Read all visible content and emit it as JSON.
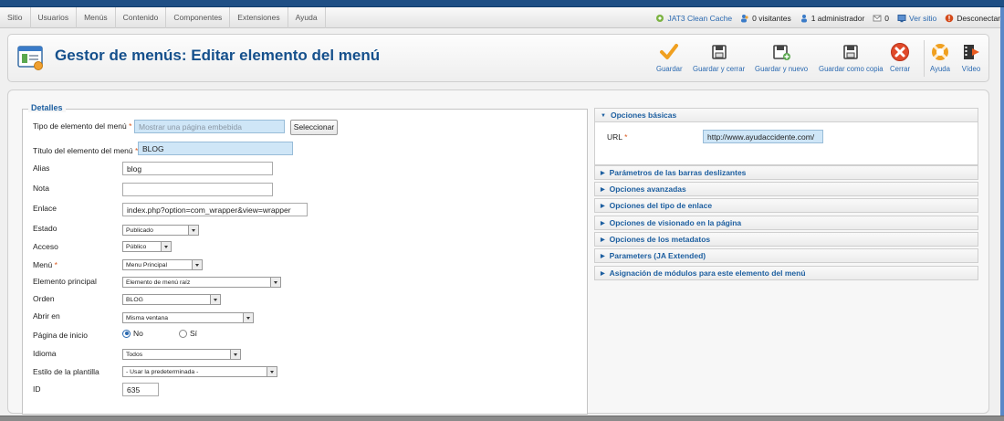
{
  "menu": [
    "Sitio",
    "Usuarios",
    "Menús",
    "Contenido",
    "Componentes",
    "Extensiones",
    "Ayuda"
  ],
  "status": {
    "cache": "JAT3 Clean Cache",
    "visitors": "0 visitantes",
    "admins": "1 administrador",
    "messages": "0",
    "view_site": "Ver sitio",
    "logout": "Desconectar"
  },
  "header": {
    "title": "Gestor de menús: Editar elemento del menú"
  },
  "toolbar": {
    "save": "Guardar",
    "save_close": "Guardar y cerrar",
    "save_new": "Guardar y nuevo",
    "save_copy": "Guardar como copia",
    "close": "Cerrar",
    "help": "Ayuda",
    "video": "Vídeo"
  },
  "details": {
    "legend": "Detalles",
    "type_label": "Tipo de elemento del menú",
    "type_value": "Mostrar una página embebida",
    "select_button": "Seleccionar",
    "title_label": "Título del elemento del menú",
    "title_value": "BLOG",
    "alias_label": "Alias",
    "alias_value": "blog",
    "note_label": "Nota",
    "note_value": "",
    "link_label": "Enlace",
    "link_value": "index.php?option=com_wrapper&view=wrapper",
    "state_label": "Estado",
    "state_value": "Publicado",
    "access_label": "Acceso",
    "access_value": "Público",
    "menu_label": "Menú",
    "menu_value": "Menu Principal",
    "parent_label": "Elemento principal",
    "parent_value": "Elemento de menú raíz",
    "order_label": "Orden",
    "order_value": "BLOG",
    "target_label": "Abrir en",
    "target_value": "Misma ventana",
    "home_label": "Página de inicio",
    "home_no": "No",
    "home_yes": "Sí",
    "home_selected": "No",
    "language_label": "Idioma",
    "language_value": "Todos",
    "template_label": "Estilo de la plantilla",
    "template_value": "- Usar la predeterminada -",
    "id_label": "ID",
    "id_value": "635"
  },
  "required_mark": "*",
  "right_panels": {
    "basic_title": "Opciones básicas",
    "url_label": "URL",
    "url_value": "http://www.ayudaccidente.com/",
    "collapsed": [
      "Parámetros de las barras deslizantes",
      "Opciones avanzadas",
      "Opciones del tipo de enlace",
      "Opciones de visionado en la página",
      "Opciones de los metadatos",
      "Parameters (JA Extended)",
      "Asignación de módulos para este elemento del menú"
    ]
  },
  "colors": {
    "accent": "#1d5fa0",
    "required": "#d95a20",
    "highlight_field": "#cfe6f7"
  }
}
